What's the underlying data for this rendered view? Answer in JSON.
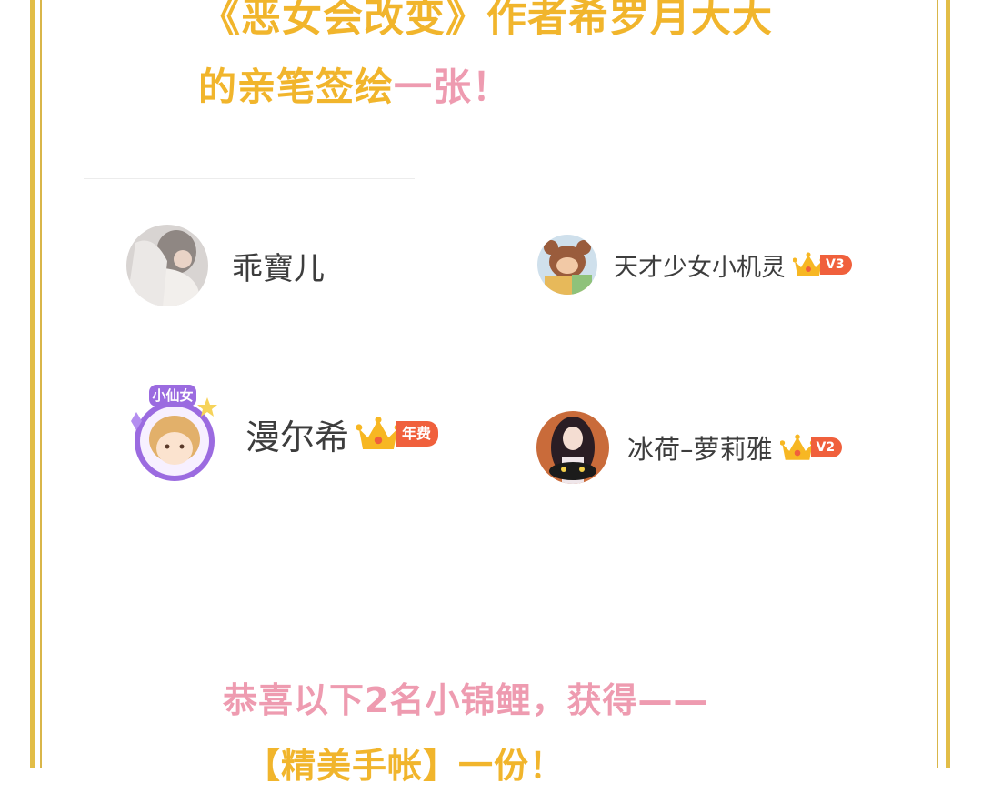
{
  "headline": {
    "line1": "《恶女会改变》作者希罗月大大",
    "line2_main": "的亲笔签绘",
    "line2_tail": "一张！"
  },
  "winners": [
    {
      "name": "乖寶儿",
      "badge": ""
    },
    {
      "name": "天才少女小机灵",
      "badge": "V3"
    },
    {
      "name": "漫尔希",
      "badge": "年费"
    },
    {
      "name": "冰荷–萝莉雅",
      "badge": "V2"
    }
  ],
  "avatar_frame_label": "小仙女",
  "congrats": "恭喜以下2名小锦鲤，获得——",
  "prize": "【精美手帐】一份！",
  "colors": {
    "gold": "#f1b52c",
    "pink": "#ee9bb0",
    "badge": "#f0603c",
    "frame": "#e2bd47"
  }
}
